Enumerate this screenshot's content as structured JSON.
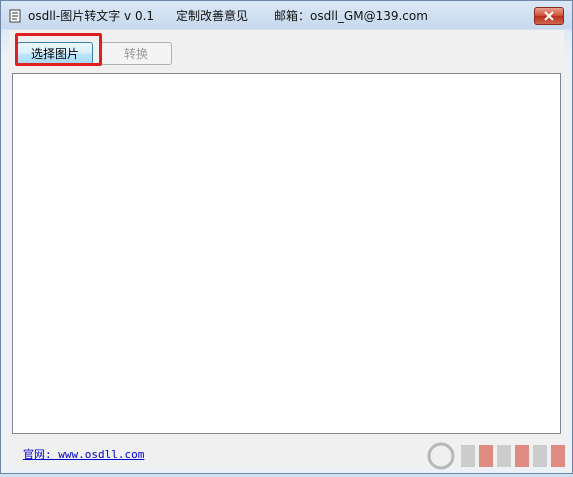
{
  "window": {
    "title": "osdll-图片转文字 v 0.1",
    "feedback_label": "定制改善意见",
    "email_label": "邮箱：osdll_GM@139.com"
  },
  "toolbar": {
    "select_image_label": "选择图片",
    "convert_label": "转换"
  },
  "text_area": {
    "value": ""
  },
  "footer": {
    "website_label": "官网: www.osdll.com"
  },
  "colors": {
    "highlight": "#e02020",
    "link": "#0000cc",
    "close_button": "#c9432c"
  },
  "icons": {
    "app": "app-icon",
    "close": "close-icon",
    "watermark": "logo-watermark"
  }
}
